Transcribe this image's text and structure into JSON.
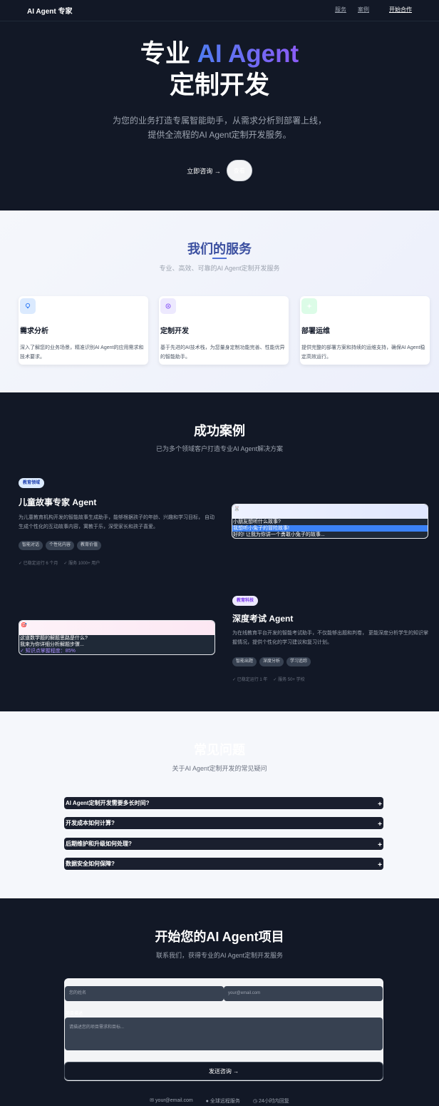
{
  "nav": {
    "brand": "AI Agent 专家",
    "links": [
      "服务",
      "案例"
    ],
    "cta": "开始合作"
  },
  "hero": {
    "title_plain": "专业 ",
    "title_accent": "AI Agent",
    "title_line2": "定制开发",
    "subtitle_line1": "为您的业务打造专属智能助手，从需求分析到部署上线，",
    "subtitle_line2": "提供全流程的AI Agent定制开发服务。",
    "primary_button": "立即咨询 →",
    "secondary_button": "查看"
  },
  "services": {
    "title": "我们的服务",
    "subtitle": "专业、高效、可靠的AI Agent定制开发服务",
    "items": [
      {
        "title": "需求分析",
        "desc": "深入了解您的业务场景，精准识别AI Agent的应用需求和技术要求。",
        "icon": "lightbulb-icon",
        "color": "#dbeafe",
        "icon_color": "#3b82f6"
      },
      {
        "title": "定制开发",
        "desc": "基于先进的AI技术栈，为您量身定制功能完善、性能优异的智能助手。",
        "icon": "gear-icon",
        "color": "#ede9fe",
        "icon_color": "#8b5cf6"
      },
      {
        "title": "部署运维",
        "desc": "提供完整的部署方案和持续的运维支持，确保AI Agent稳定高效运行。",
        "icon": "sparkle-icon",
        "color": "#dcfce7",
        "icon_color": "#22c55e"
      }
    ]
  },
  "cases": {
    "title": "成功案例",
    "subtitle": "已为多个领域客户打造专业AI Agent解决方案",
    "items": [
      {
        "badge": "教育领域",
        "title": "儿童故事专家 Agent",
        "desc": "为儿童教育机构开发的智能故事生成助手，能够根据孩子的年龄、兴趣和学习目标，  自动生成个性化的互动故事内容，寓教于乐，深受家长和孩子喜爱。",
        "tags": [
          "智能对话",
          "个性化内容",
          "教育价值"
        ],
        "stats": [
          "✓ 已稳定运行 6 个月",
          "✓ 服务 1000+ 用户"
        ],
        "chat": [
          "小朋友想听什么故事?",
          "我想听小兔子的冒险故事!",
          "好的! 让我为你讲一个勇敢小兔子的故事..."
        ],
        "chat_icon": "🐰"
      },
      {
        "badge": "教育科技",
        "title": "深度考试 Agent",
        "desc": "为在线教育平台开发的智能考试助手，不仅能够出题和判卷，  更能深度分析学生的知识掌握情况，提供个性化的学习建议和复习计划。",
        "tags": [
          "智能出题",
          "深度分析",
          "学习追踪"
        ],
        "stats": [
          "✓ 已稳定运行 1 年",
          "✓ 服务 50+ 学校"
        ],
        "chat": [
          "这道数学题的解题思路是什么?",
          "我来为你详细分析解题步骤...",
          "✓ 知识点掌握程度：85%"
        ],
        "chat_icon": "🎯"
      }
    ]
  },
  "faq": {
    "title": "常见问题",
    "subtitle": "关于AI Agent定制开发的常见疑问",
    "items": [
      "AI Agent定制开发需要多长时间?",
      "开发成本如何计算?",
      "后期维护和升级如何处理?",
      "数据安全如何保障?"
    ]
  },
  "contact": {
    "title": "开始您的AI Agent项目",
    "subtitle": "联系我们，获得专业的AI Agent定制开发服务",
    "name_placeholder": "您的姓名",
    "email_placeholder": "your@email.com",
    "desc_label": "项目描述",
    "desc_placeholder": "请描述您的项目需求和目标...",
    "submit": "发送咨询 →",
    "footer": [
      "your@email.com",
      "全球远程服务",
      "24小时内回复"
    ]
  }
}
